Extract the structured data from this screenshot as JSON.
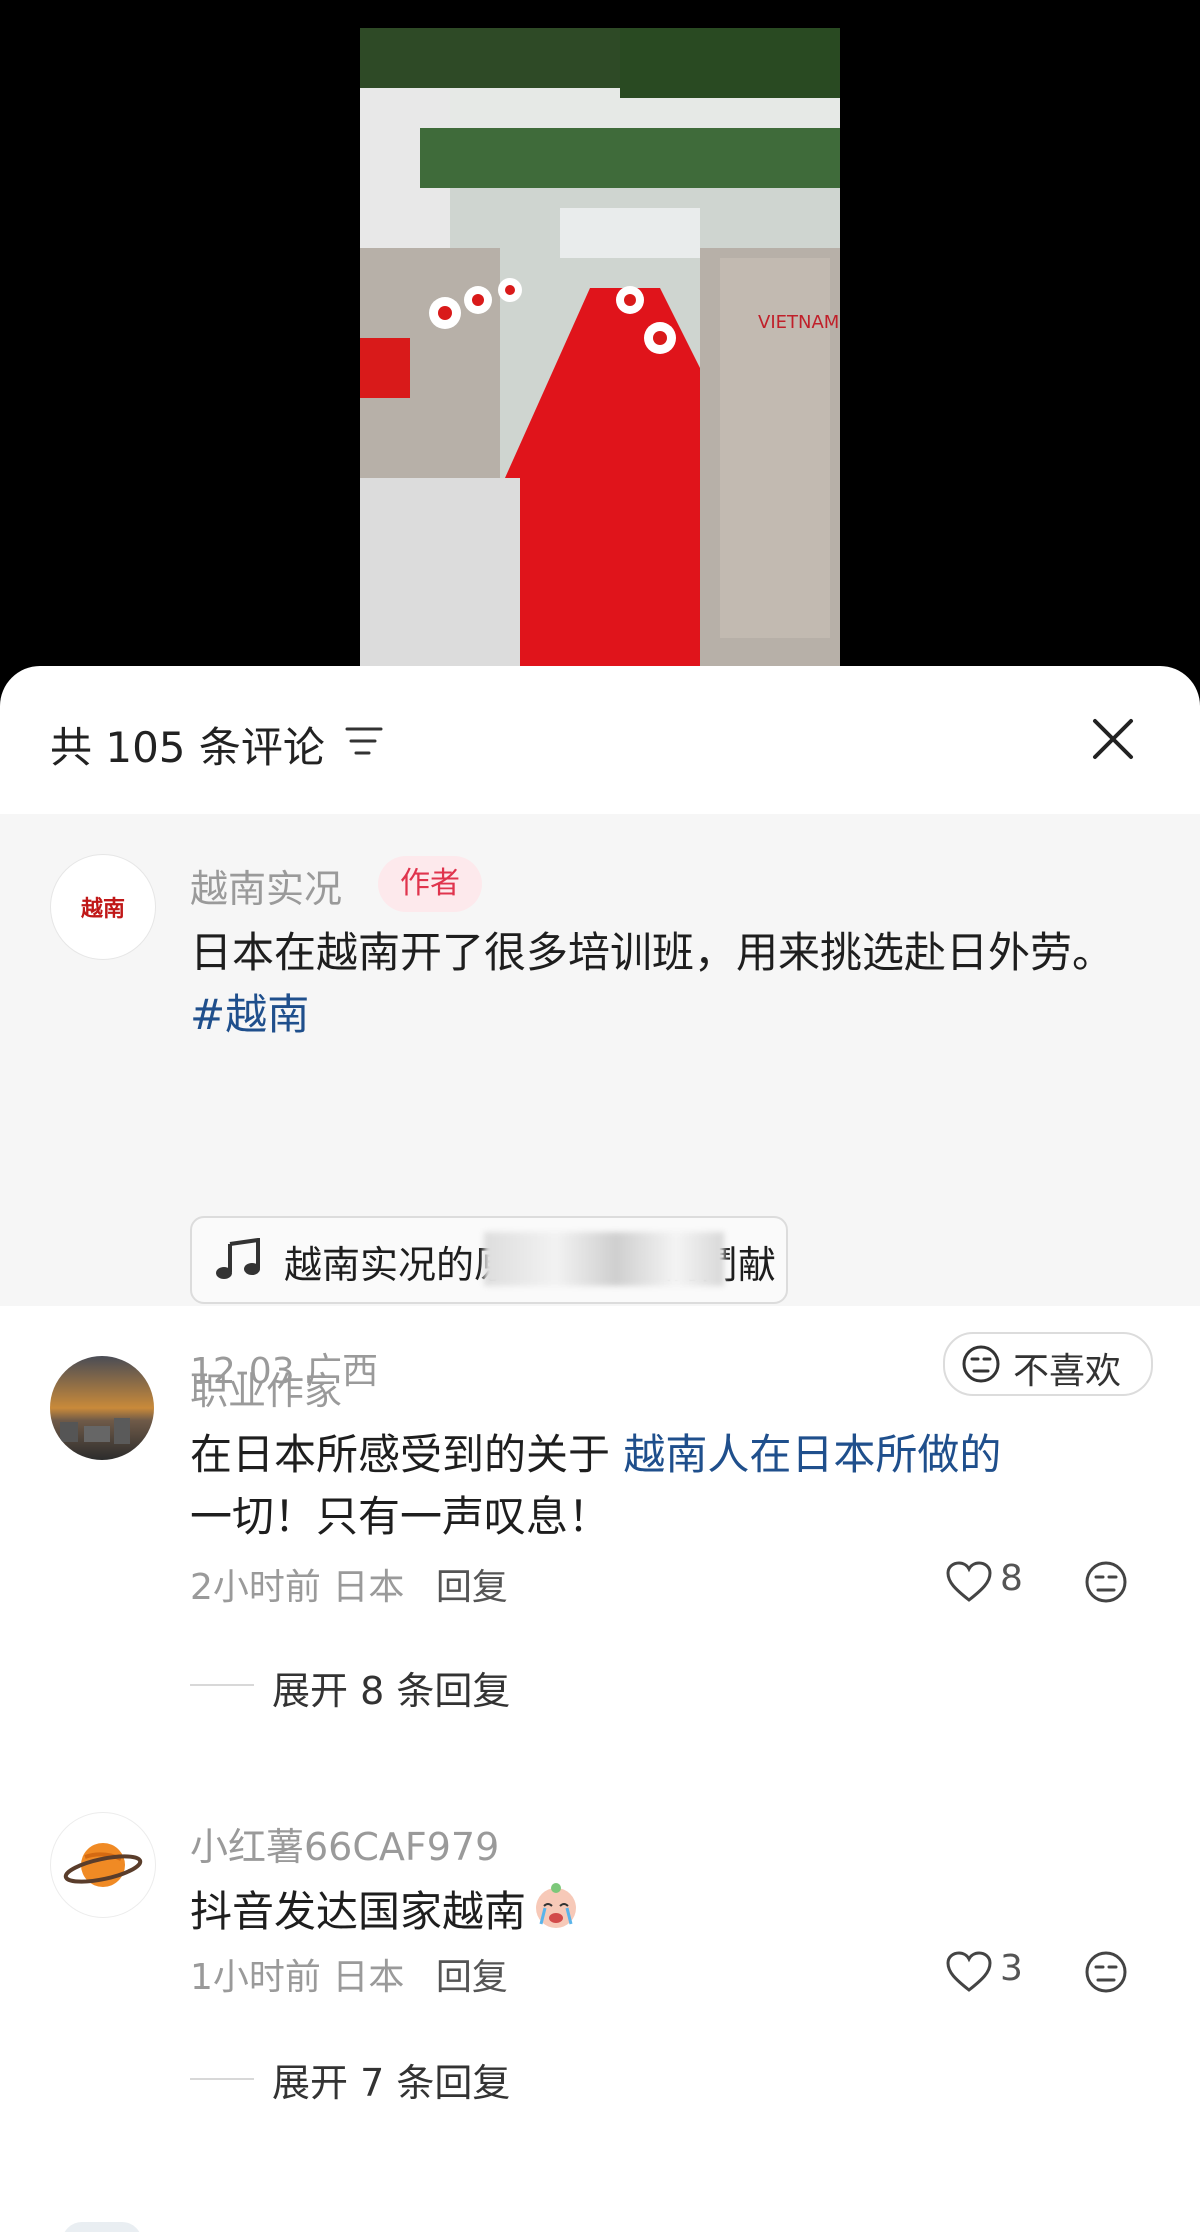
{
  "comments_header": {
    "count_text": "共 105 条评论"
  },
  "author_comment": {
    "username": "越南实况",
    "avatar_text": "越南",
    "author_badge": "作者",
    "text": "日本在越南开了很多培训班，用来挑选赴日外劳。",
    "hashtag": "#越南",
    "music_label": "越南实况的原",
    "music_label_tail": "们鬥献",
    "date": "12-03",
    "location": "广西",
    "dislike_label": "不喜欢"
  },
  "comments": [
    {
      "username": "职业作家",
      "text_before": "在日本所感受到的关于 ",
      "text_link": "越南人在日本所做的",
      "text_after": "一切！只有一声叹息！",
      "time": "2小时前",
      "location": "日本",
      "reply_label": "回复",
      "likes": "8",
      "expand_label": "展开 8 条回复"
    },
    {
      "username": "小红薯66CAF979",
      "text": "抖音发达国家越南",
      "time": "1小时前",
      "location": "日本",
      "reply_label": "回复",
      "likes": "3",
      "expand_label": "展开 7 条回复"
    }
  ],
  "colors": {
    "link": "#1f4f8c",
    "author_badge_bg": "#fde9ec",
    "author_badge_text": "#e0344d",
    "carpet_red": "#e0141b"
  },
  "icons": [
    "sort-icon",
    "close-icon",
    "music-note-icon",
    "dislike-face-icon",
    "heart-icon",
    "planet-avatar-icon"
  ]
}
